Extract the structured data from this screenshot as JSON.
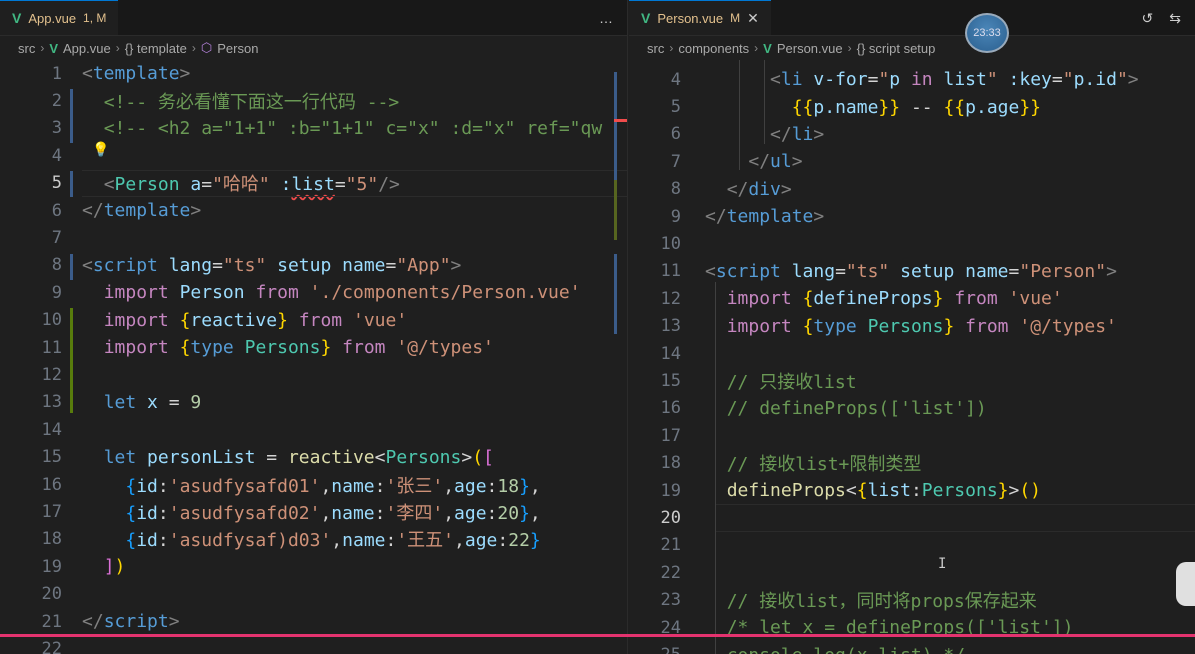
{
  "left": {
    "tab": {
      "name": "App.vue",
      "status": "1, M",
      "icon": "vue-icon"
    },
    "actions": [
      "…"
    ],
    "breadcrumb": [
      "src",
      "App.vue",
      "{} template",
      "Person"
    ],
    "lines": [
      {
        "n": "1",
        "tokens": [
          [
            "t-punct",
            "<"
          ],
          [
            "t-tag",
            "template"
          ],
          [
            "t-punct",
            ">"
          ]
        ]
      },
      {
        "n": "2",
        "tokens": [
          [
            "t-plain",
            "  "
          ],
          [
            "t-comment",
            "<!-- 务必看懂下面这一行代码 -->"
          ]
        ]
      },
      {
        "n": "3",
        "tokens": [
          [
            "t-plain",
            "  "
          ],
          [
            "t-comment",
            "<!-- <h2 a=\"1+1\" :b=\"1+1\" c=\"x\" :d=\"x\" ref=\"qw"
          ]
        ]
      },
      {
        "n": "4",
        "tokens": []
      },
      {
        "n": "5",
        "tokens": [
          [
            "t-plain",
            "  "
          ],
          [
            "t-punct",
            "<"
          ],
          [
            "t-type",
            "Person"
          ],
          [
            "t-plain",
            " "
          ],
          [
            "t-attr",
            "a"
          ],
          [
            "t-plain",
            "="
          ],
          [
            "t-str",
            "\"哈哈\""
          ],
          [
            "t-plain",
            " "
          ],
          [
            "t-attr",
            ":"
          ],
          [
            "t-attr t-squiggle",
            "list"
          ],
          [
            "t-plain",
            "="
          ],
          [
            "t-str",
            "\"5\""
          ],
          [
            "t-punct",
            "/>"
          ]
        ]
      },
      {
        "n": "6",
        "tokens": [
          [
            "t-punct",
            "</"
          ],
          [
            "t-tag",
            "template"
          ],
          [
            "t-punct",
            ">"
          ]
        ]
      },
      {
        "n": "7",
        "tokens": []
      },
      {
        "n": "8",
        "tokens": [
          [
            "t-punct",
            "<"
          ],
          [
            "t-tag",
            "script"
          ],
          [
            "t-plain",
            " "
          ],
          [
            "t-attr",
            "lang"
          ],
          [
            "t-plain",
            "="
          ],
          [
            "t-str",
            "\"ts\""
          ],
          [
            "t-plain",
            " "
          ],
          [
            "t-attr",
            "setup"
          ],
          [
            "t-plain",
            " "
          ],
          [
            "t-attr",
            "name"
          ],
          [
            "t-plain",
            "="
          ],
          [
            "t-str",
            "\"App\""
          ],
          [
            "t-punct",
            ">"
          ]
        ]
      },
      {
        "n": "9",
        "tokens": [
          [
            "t-plain",
            "  "
          ],
          [
            "t-kw",
            "import"
          ],
          [
            "t-plain",
            " "
          ],
          [
            "t-var",
            "Person"
          ],
          [
            "t-plain",
            " "
          ],
          [
            "t-kw",
            "from"
          ],
          [
            "t-plain",
            " "
          ],
          [
            "t-str",
            "'./components/Person.vue'"
          ]
        ]
      },
      {
        "n": "10",
        "tokens": [
          [
            "t-plain",
            "  "
          ],
          [
            "t-kw",
            "import"
          ],
          [
            "t-plain",
            " "
          ],
          [
            "t-brace",
            "{"
          ],
          [
            "t-var",
            "reactive"
          ],
          [
            "t-brace",
            "}"
          ],
          [
            "t-plain",
            " "
          ],
          [
            "t-kw",
            "from"
          ],
          [
            "t-plain",
            " "
          ],
          [
            "t-str",
            "'vue'"
          ]
        ]
      },
      {
        "n": "11",
        "tokens": [
          [
            "t-plain",
            "  "
          ],
          [
            "t-kw",
            "import"
          ],
          [
            "t-plain",
            " "
          ],
          [
            "t-brace",
            "{"
          ],
          [
            "t-kw2",
            "type"
          ],
          [
            "t-plain",
            " "
          ],
          [
            "t-type",
            "Persons"
          ],
          [
            "t-brace",
            "}"
          ],
          [
            "t-plain",
            " "
          ],
          [
            "t-kw",
            "from"
          ],
          [
            "t-plain",
            " "
          ],
          [
            "t-str",
            "'@/types'"
          ]
        ]
      },
      {
        "n": "12",
        "tokens": []
      },
      {
        "n": "13",
        "tokens": [
          [
            "t-plain",
            "  "
          ],
          [
            "t-kw2",
            "let"
          ],
          [
            "t-plain",
            " "
          ],
          [
            "t-var",
            "x"
          ],
          [
            "t-plain",
            " = "
          ],
          [
            "t-num",
            "9"
          ]
        ]
      },
      {
        "n": "14",
        "tokens": []
      },
      {
        "n": "15",
        "tokens": [
          [
            "t-plain",
            "  "
          ],
          [
            "t-kw2",
            "let"
          ],
          [
            "t-plain",
            " "
          ],
          [
            "t-var",
            "personList"
          ],
          [
            "t-plain",
            " = "
          ],
          [
            "t-fn",
            "reactive"
          ],
          [
            "t-plain",
            "<"
          ],
          [
            "t-type",
            "Persons"
          ],
          [
            "t-plain",
            ">"
          ],
          [
            "t-brace",
            "("
          ],
          [
            "t-brace2",
            "["
          ]
        ]
      },
      {
        "n": "16",
        "tokens": [
          [
            "t-plain",
            "    "
          ],
          [
            "t-brace3",
            "{"
          ],
          [
            "t-var",
            "id"
          ],
          [
            "t-plain",
            ":"
          ],
          [
            "t-str",
            "'asudfysafd01'"
          ],
          [
            "t-plain",
            ","
          ],
          [
            "t-var",
            "name"
          ],
          [
            "t-plain",
            ":"
          ],
          [
            "t-str",
            "'张三'"
          ],
          [
            "t-plain",
            ","
          ],
          [
            "t-var",
            "age"
          ],
          [
            "t-plain",
            ":"
          ],
          [
            "t-num",
            "18"
          ],
          [
            "t-brace3",
            "}"
          ],
          [
            "t-plain",
            ","
          ]
        ]
      },
      {
        "n": "17",
        "tokens": [
          [
            "t-plain",
            "    "
          ],
          [
            "t-brace3",
            "{"
          ],
          [
            "t-var",
            "id"
          ],
          [
            "t-plain",
            ":"
          ],
          [
            "t-str",
            "'asudfysafd02'"
          ],
          [
            "t-plain",
            ","
          ],
          [
            "t-var",
            "name"
          ],
          [
            "t-plain",
            ":"
          ],
          [
            "t-str",
            "'李四'"
          ],
          [
            "t-plain",
            ","
          ],
          [
            "t-var",
            "age"
          ],
          [
            "t-plain",
            ":"
          ],
          [
            "t-num",
            "20"
          ],
          [
            "t-brace3",
            "}"
          ],
          [
            "t-plain",
            ","
          ]
        ]
      },
      {
        "n": "18",
        "tokens": [
          [
            "t-plain",
            "    "
          ],
          [
            "t-brace3",
            "{"
          ],
          [
            "t-var",
            "id"
          ],
          [
            "t-plain",
            ":"
          ],
          [
            "t-str",
            "'asudfysaf)d03'"
          ],
          [
            "t-plain",
            ","
          ],
          [
            "t-var",
            "name"
          ],
          [
            "t-plain",
            ":"
          ],
          [
            "t-str",
            "'王五'"
          ],
          [
            "t-plain",
            ","
          ],
          [
            "t-var",
            "age"
          ],
          [
            "t-plain",
            ":"
          ],
          [
            "t-num",
            "22"
          ],
          [
            "t-brace3",
            "}"
          ]
        ]
      },
      {
        "n": "19",
        "tokens": [
          [
            "t-plain",
            "  "
          ],
          [
            "t-brace2",
            "]"
          ],
          [
            "t-brace",
            ")"
          ]
        ]
      },
      {
        "n": "20",
        "tokens": []
      },
      {
        "n": "21",
        "tokens": [
          [
            "t-punct",
            "</"
          ],
          [
            "t-tag",
            "script"
          ],
          [
            "t-punct",
            ">"
          ]
        ]
      },
      {
        "n": "22",
        "tokens": []
      }
    ]
  },
  "right": {
    "tab": {
      "name": "Person.vue",
      "status": "M",
      "icon": "vue-icon",
      "close": "✕"
    },
    "actions": [
      "history-icon",
      "compare-icon"
    ],
    "breadcrumb": [
      "src",
      "components",
      "Person.vue",
      "{} script setup"
    ],
    "clock": "23:33",
    "lines": [
      {
        "n": "4",
        "tokens": [
          [
            "t-plain",
            "      "
          ],
          [
            "t-punct",
            "<"
          ],
          [
            "t-tag",
            "li"
          ],
          [
            "t-plain",
            " "
          ],
          [
            "t-attr",
            "v-for"
          ],
          [
            "t-plain",
            "="
          ],
          [
            "t-str",
            "\""
          ],
          [
            "t-var",
            "p"
          ],
          [
            "t-plain",
            " "
          ],
          [
            "t-kw",
            "in"
          ],
          [
            "t-plain",
            " "
          ],
          [
            "t-var",
            "list"
          ],
          [
            "t-str",
            "\""
          ],
          [
            "t-plain",
            " "
          ],
          [
            "t-attr",
            ":key"
          ],
          [
            "t-plain",
            "="
          ],
          [
            "t-str",
            "\""
          ],
          [
            "t-var",
            "p.id"
          ],
          [
            "t-str",
            "\""
          ],
          [
            "t-punct",
            ">"
          ]
        ]
      },
      {
        "n": "5",
        "tokens": [
          [
            "t-plain",
            "        "
          ],
          [
            "t-brace",
            "{{"
          ],
          [
            "t-var",
            "p.name"
          ],
          [
            "t-brace",
            "}}"
          ],
          [
            "t-plain",
            " -- "
          ],
          [
            "t-brace",
            "{{"
          ],
          [
            "t-var",
            "p.age"
          ],
          [
            "t-brace",
            "}}"
          ]
        ]
      },
      {
        "n": "6",
        "tokens": [
          [
            "t-plain",
            "      "
          ],
          [
            "t-punct",
            "</"
          ],
          [
            "t-tag",
            "li"
          ],
          [
            "t-punct",
            ">"
          ]
        ]
      },
      {
        "n": "7",
        "tokens": [
          [
            "t-plain",
            "    "
          ],
          [
            "t-punct",
            "</"
          ],
          [
            "t-tag",
            "ul"
          ],
          [
            "t-punct",
            ">"
          ]
        ]
      },
      {
        "n": "8",
        "tokens": [
          [
            "t-plain",
            "  "
          ],
          [
            "t-punct",
            "</"
          ],
          [
            "t-tag",
            "div"
          ],
          [
            "t-punct",
            ">"
          ]
        ]
      },
      {
        "n": "9",
        "tokens": [
          [
            "t-punct",
            "</"
          ],
          [
            "t-tag",
            "template"
          ],
          [
            "t-punct",
            ">"
          ]
        ]
      },
      {
        "n": "10",
        "tokens": []
      },
      {
        "n": "11",
        "tokens": [
          [
            "t-punct",
            "<"
          ],
          [
            "t-tag",
            "script"
          ],
          [
            "t-plain",
            " "
          ],
          [
            "t-attr",
            "lang"
          ],
          [
            "t-plain",
            "="
          ],
          [
            "t-str",
            "\"ts\""
          ],
          [
            "t-plain",
            " "
          ],
          [
            "t-attr",
            "setup"
          ],
          [
            "t-plain",
            " "
          ],
          [
            "t-attr",
            "name"
          ],
          [
            "t-plain",
            "="
          ],
          [
            "t-str",
            "\"Person\""
          ],
          [
            "t-punct",
            ">"
          ]
        ]
      },
      {
        "n": "12",
        "tokens": [
          [
            "t-plain",
            "  "
          ],
          [
            "t-kw",
            "import"
          ],
          [
            "t-plain",
            " "
          ],
          [
            "t-brace",
            "{"
          ],
          [
            "t-var",
            "defineProps"
          ],
          [
            "t-brace",
            "}"
          ],
          [
            "t-plain",
            " "
          ],
          [
            "t-kw",
            "from"
          ],
          [
            "t-plain",
            " "
          ],
          [
            "t-str",
            "'vue'"
          ]
        ]
      },
      {
        "n": "13",
        "tokens": [
          [
            "t-plain",
            "  "
          ],
          [
            "t-kw",
            "import"
          ],
          [
            "t-plain",
            " "
          ],
          [
            "t-brace",
            "{"
          ],
          [
            "t-kw2",
            "type"
          ],
          [
            "t-plain",
            " "
          ],
          [
            "t-type",
            "Persons"
          ],
          [
            "t-brace",
            "}"
          ],
          [
            "t-plain",
            " "
          ],
          [
            "t-kw",
            "from"
          ],
          [
            "t-plain",
            " "
          ],
          [
            "t-str",
            "'@/types'"
          ]
        ]
      },
      {
        "n": "14",
        "tokens": []
      },
      {
        "n": "15",
        "tokens": [
          [
            "t-plain",
            "  "
          ],
          [
            "t-comment",
            "// 只接收list"
          ]
        ]
      },
      {
        "n": "16",
        "tokens": [
          [
            "t-plain",
            "  "
          ],
          [
            "t-comment",
            "// defineProps(['list'])"
          ]
        ]
      },
      {
        "n": "17",
        "tokens": []
      },
      {
        "n": "18",
        "tokens": [
          [
            "t-plain",
            "  "
          ],
          [
            "t-comment",
            "// 接收list+限制类型"
          ]
        ]
      },
      {
        "n": "19",
        "tokens": [
          [
            "t-plain",
            "  "
          ],
          [
            "t-fn",
            "defineProps"
          ],
          [
            "t-plain",
            "<"
          ],
          [
            "t-brace",
            "{"
          ],
          [
            "t-var",
            "list"
          ],
          [
            "t-plain",
            ":"
          ],
          [
            "t-type",
            "Persons"
          ],
          [
            "t-brace",
            "}"
          ],
          [
            "t-plain",
            ">"
          ],
          [
            "t-brace",
            "()"
          ]
        ]
      },
      {
        "n": "20",
        "tokens": []
      },
      {
        "n": "21",
        "tokens": []
      },
      {
        "n": "22",
        "tokens": []
      },
      {
        "n": "23",
        "tokens": [
          [
            "t-plain",
            "  "
          ],
          [
            "t-comment",
            "// 接收list，同时将props保存起来"
          ]
        ]
      },
      {
        "n": "24",
        "tokens": [
          [
            "t-plain",
            "  "
          ],
          [
            "t-comment",
            "/* let x = defineProps(['list'])"
          ]
        ]
      },
      {
        "n": "25",
        "tokens": [
          [
            "t-plain",
            "  "
          ],
          [
            "t-comment",
            "console.log(x.list) */"
          ]
        ]
      }
    ]
  },
  "progress": {
    "fraction": 0.76
  }
}
